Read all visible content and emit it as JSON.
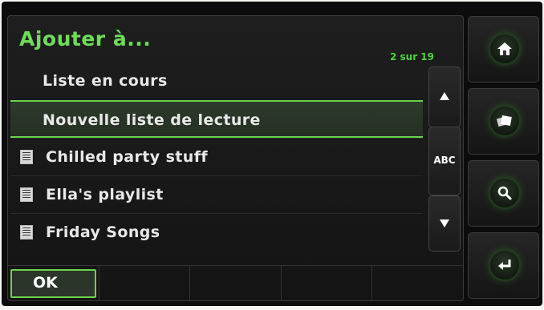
{
  "header": {
    "title": "Ajouter à...",
    "counter": "2 sur 19"
  },
  "list": {
    "items": [
      {
        "label": "Liste en cours",
        "type": "plain",
        "selected": false
      },
      {
        "label": "Nouvelle liste de lecture",
        "type": "plain",
        "selected": true
      },
      {
        "label": "Chilled party stuff",
        "type": "playlist",
        "selected": false
      },
      {
        "label": "Ella's playlist",
        "type": "playlist",
        "selected": false
      },
      {
        "label": "Friday Songs",
        "type": "playlist",
        "selected": false
      }
    ]
  },
  "scroll": {
    "up_icon": "arrow-up-icon",
    "index_label": "ABC",
    "down_icon": "arrow-down-icon"
  },
  "bottom_bar": {
    "ok_label": "OK"
  },
  "rail": {
    "icons": [
      "home-icon",
      "browse-icon",
      "search-icon",
      "back-icon"
    ]
  },
  "colors": {
    "accent": "#6fdc5a",
    "selection_border": "#6ad34e",
    "background": "#141414"
  }
}
